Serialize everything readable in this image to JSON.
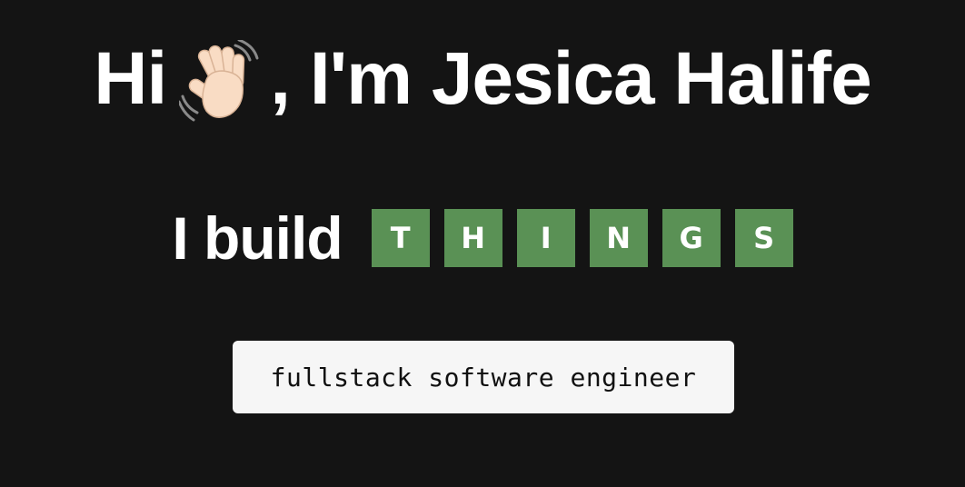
{
  "hero": {
    "greeting_before": "Hi",
    "greeting_after": ", I'm Jesica Halife",
    "wave_icon": "waving-hand-icon"
  },
  "tagline": {
    "lead": "I build",
    "tiles": [
      "T",
      "H",
      "I",
      "N",
      "G",
      "S"
    ],
    "tile_color": "#5a9155"
  },
  "role": {
    "label": "fullstack software engineer"
  },
  "colors": {
    "background": "#141414",
    "text": "#ffffff",
    "chip_background": "#f6f6f6"
  }
}
